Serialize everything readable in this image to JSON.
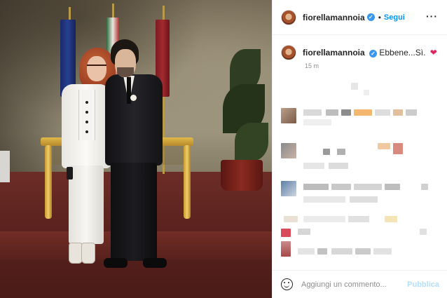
{
  "post": {
    "username": "fiorellamannoia",
    "verified_icon": "verified-badge-icon",
    "separator": "•",
    "follow_label": "Segui",
    "more_icon": "more-options-icon",
    "more_label": "···",
    "caption_username": "fiorellamannoia",
    "caption_text": "Ebbene...Sì.",
    "caption_emoji": "❤",
    "timestamp": "15 m"
  },
  "comment_box": {
    "emoji_icon": "emoji-icon",
    "placeholder": "Aggiungi un commento...",
    "publish_label": "Pubblica"
  },
  "colors": {
    "accent_blue": "#0095f6",
    "verified_blue": "#3897f0",
    "publish_disabled": "#b2dffc",
    "heart_red": "#e0245e",
    "timestamp_gray": "#8e8e8e"
  }
}
